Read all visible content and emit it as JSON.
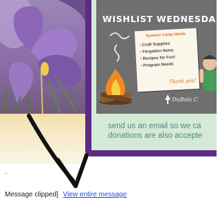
{
  "newsletter": {
    "title": "WISHLIST WEDNESDA",
    "note": {
      "title": "Summer Camp Needs",
      "items": [
        "Craft Supplies",
        "Forgotten Items",
        "Recipes for Fun!",
        "Program Needs"
      ],
      "thanks": "Thank you!"
    },
    "logo_text": "DuBois C",
    "body_line1": "send us an email so we ca",
    "body_line2": "donations are also accepte"
  },
  "footer": {
    "dots": "..",
    "clipped_text": "Message clipped]",
    "view_link": "View entire message"
  },
  "colors": {
    "card_purple": "#5d2b86",
    "card_green": "#d4ead7",
    "text_teal": "#4d8a86",
    "link_blue": "#1a4fd6"
  }
}
